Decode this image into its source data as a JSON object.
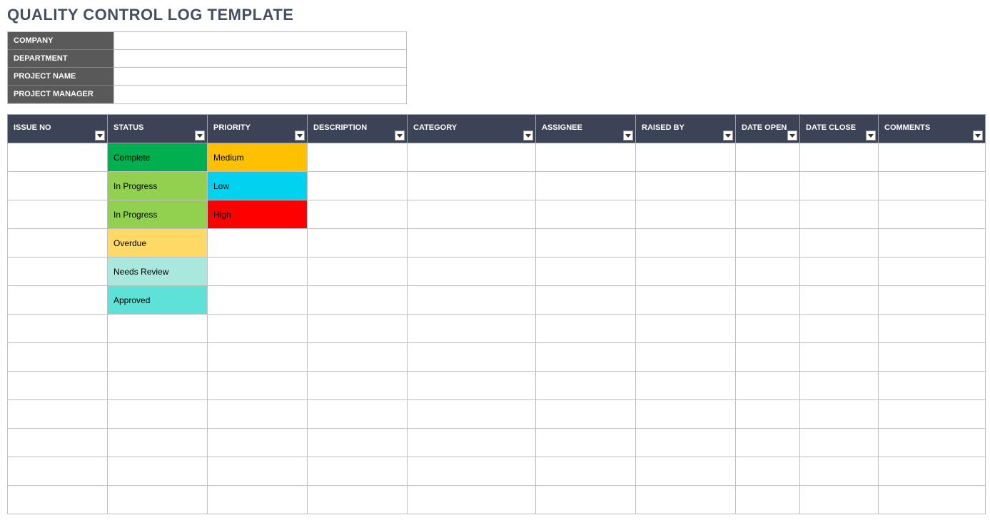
{
  "title": "QUALITY CONTROL LOG TEMPLATE",
  "info_labels": {
    "company": "COMPANY",
    "department": "DEPARTMENT",
    "project_name": "PROJECT NAME",
    "project_manager": "PROJECT MANAGER"
  },
  "info_values": {
    "company": "",
    "department": "",
    "project_name": "",
    "project_manager": ""
  },
  "columns": [
    "ISSUE NO",
    "STATUS",
    "PRIORITY",
    "DESCRIPTION",
    "CATEGORY",
    "ASSIGNEE",
    "RAISED BY",
    "DATE OPEN",
    "DATE CLOSE",
    "COMMENTS"
  ],
  "status_styles": {
    "Complete": "st-complete",
    "In Progress": "st-inprogress",
    "Overdue": "st-overdue",
    "Needs Review": "st-needsrev",
    "Approved": "st-approved"
  },
  "priority_styles": {
    "Medium": "pr-medium",
    "Low": "pr-low",
    "High": "pr-high"
  },
  "rows": [
    {
      "issue_no": "",
      "status": "Complete",
      "priority": "Medium",
      "description": "",
      "category": "",
      "assignee": "",
      "raised_by": "",
      "date_open": "",
      "date_close": "",
      "comments": ""
    },
    {
      "issue_no": "",
      "status": "In Progress",
      "priority": "Low",
      "description": "",
      "category": "",
      "assignee": "",
      "raised_by": "",
      "date_open": "",
      "date_close": "",
      "comments": ""
    },
    {
      "issue_no": "",
      "status": "In Progress",
      "priority": "High",
      "description": "",
      "category": "",
      "assignee": "",
      "raised_by": "",
      "date_open": "",
      "date_close": "",
      "comments": ""
    },
    {
      "issue_no": "",
      "status": "Overdue",
      "priority": "",
      "description": "",
      "category": "",
      "assignee": "",
      "raised_by": "",
      "date_open": "",
      "date_close": "",
      "comments": ""
    },
    {
      "issue_no": "",
      "status": "Needs Review",
      "priority": "",
      "description": "",
      "category": "",
      "assignee": "",
      "raised_by": "",
      "date_open": "",
      "date_close": "",
      "comments": ""
    },
    {
      "issue_no": "",
      "status": "Approved",
      "priority": "",
      "description": "",
      "category": "",
      "assignee": "",
      "raised_by": "",
      "date_open": "",
      "date_close": "",
      "comments": ""
    },
    {
      "issue_no": "",
      "status": "",
      "priority": "",
      "description": "",
      "category": "",
      "assignee": "",
      "raised_by": "",
      "date_open": "",
      "date_close": "",
      "comments": ""
    },
    {
      "issue_no": "",
      "status": "",
      "priority": "",
      "description": "",
      "category": "",
      "assignee": "",
      "raised_by": "",
      "date_open": "",
      "date_close": "",
      "comments": ""
    },
    {
      "issue_no": "",
      "status": "",
      "priority": "",
      "description": "",
      "category": "",
      "assignee": "",
      "raised_by": "",
      "date_open": "",
      "date_close": "",
      "comments": ""
    },
    {
      "issue_no": "",
      "status": "",
      "priority": "",
      "description": "",
      "category": "",
      "assignee": "",
      "raised_by": "",
      "date_open": "",
      "date_close": "",
      "comments": ""
    },
    {
      "issue_no": "",
      "status": "",
      "priority": "",
      "description": "",
      "category": "",
      "assignee": "",
      "raised_by": "",
      "date_open": "",
      "date_close": "",
      "comments": ""
    },
    {
      "issue_no": "",
      "status": "",
      "priority": "",
      "description": "",
      "category": "",
      "assignee": "",
      "raised_by": "",
      "date_open": "",
      "date_close": "",
      "comments": ""
    },
    {
      "issue_no": "",
      "status": "",
      "priority": "",
      "description": "",
      "category": "",
      "assignee": "",
      "raised_by": "",
      "date_open": "",
      "date_close": "",
      "comments": ""
    }
  ]
}
